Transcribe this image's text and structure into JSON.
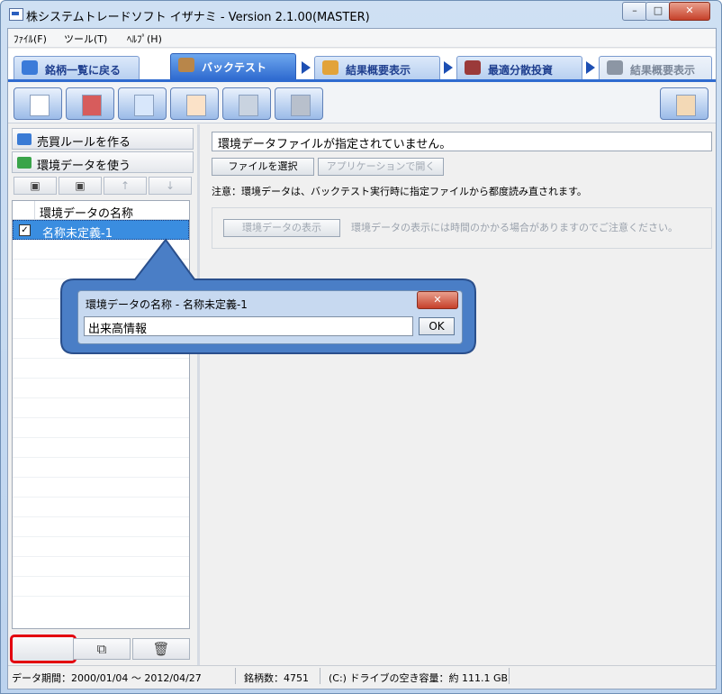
{
  "window": {
    "title": "株システムトレードソフト イザナミ - Version 2.1.00(MASTER)",
    "controls": {
      "minimize": "–",
      "maximize": "□",
      "close": "✕"
    }
  },
  "menu": [
    "ﾌｧｲﾙ(F)",
    "ツール(T)",
    "ﾍﾙﾌﾟ(H)"
  ],
  "tabs": [
    {
      "label": "銘柄一覧に戻る",
      "icon": "list-icon",
      "state": "normal"
    },
    {
      "label": "バックテスト",
      "icon": "bag-icon",
      "state": "active"
    },
    {
      "label": "結果概要表示",
      "icon": "chart-icon",
      "state": "normal"
    },
    {
      "label": "最適分散投資",
      "icon": "grid-icon",
      "state": "normal"
    },
    {
      "label": "結果概要表示",
      "icon": "factory-icon",
      "state": "disabled"
    }
  ],
  "toolbar": {
    "buttons": [
      "new-document-icon",
      "save-icon",
      "export-icon",
      "import-icon",
      "wand-icon",
      "tools-icon"
    ],
    "right_button": "phone-icon"
  },
  "left": {
    "buttons": [
      "売買ルールを作る",
      "環境データを使う"
    ],
    "mini_toolbar": [
      "save-icon",
      "save-as-icon",
      "up-arrow-icon",
      "down-arrow-icon"
    ],
    "list_header": "環境データの名称",
    "items": [
      {
        "label": "名称未定義-1",
        "checked": true
      }
    ],
    "bottom_buttons": {
      "add": "+",
      "copy": "⧉",
      "delete": "🗑"
    }
  },
  "right": {
    "file_status": "環境データファイルが指定されていません。",
    "select_file_button": "ファイルを選択",
    "open_app_button": "アプリケーションで開く",
    "note": "注意：環境データは、バックテスト実行時に指定ファイルから都度読み直されます。",
    "show_button": "環境データの表示",
    "hint": "環境データの表示には時間のかかる場合がありますのでご注意ください。"
  },
  "dialog": {
    "title": "環境データの名称 - 名称未定義-1",
    "input_value": "出来高情報",
    "ok": "OK",
    "close": "✕"
  },
  "status": {
    "period": "データ期間：2000/01/04 〜 2012/04/27",
    "count": "銘柄数：4751",
    "disk": "(C:) ドライブの空き容量：約 111.1 GB"
  },
  "colors": {
    "accent": "#2f6bd0",
    "highlight": "#e3000f",
    "callout": "#3b6fb6"
  }
}
